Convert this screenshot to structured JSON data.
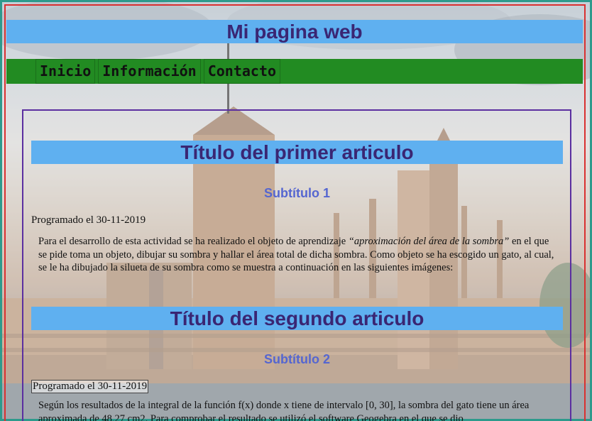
{
  "header": {
    "title": "Mi pagina web"
  },
  "nav": {
    "items": [
      "Inicio",
      "Información",
      "Contacto"
    ]
  },
  "articles": [
    {
      "title": "Título del primer articulo",
      "subtitle": "Subtítulo 1",
      "date": "Programado el 30-11-2019",
      "body_before": "Para el desarrollo de esta actividad se ha realizado el objeto de aprendizaje ",
      "body_em": "“aproximación del área de la sombra”",
      "body_after": " en el que se pide toma un objeto, dibujar su sombra y hallar el área total de dicha sombra. Como objeto se ha escogido un gato, al cual, se le ha dibujado la silueta de su sombra como se muestra a continuación en las siguientes imágenes:"
    },
    {
      "title": "Título del segundo articulo",
      "subtitle": "Subtítulo 2",
      "date": "Programado el 30-11-2019",
      "body": "Según los resultados de la integral de la función f(x) donde x tiene de intervalo [0, 30], la sombra del gato tiene un área aproximada de 48,27 cm2. Para comprobar el resultado se utilizó el software Geogebra en el que se dio"
    }
  ],
  "colors": {
    "header_bg": "#5fb0f0",
    "title_text": "#3a2673",
    "nav_bg": "#228b22",
    "subtitle_text": "#5566d0",
    "main_border": "#5b2fa0",
    "frame_red": "#d93030",
    "frame_teal": "#2d9a8c"
  }
}
